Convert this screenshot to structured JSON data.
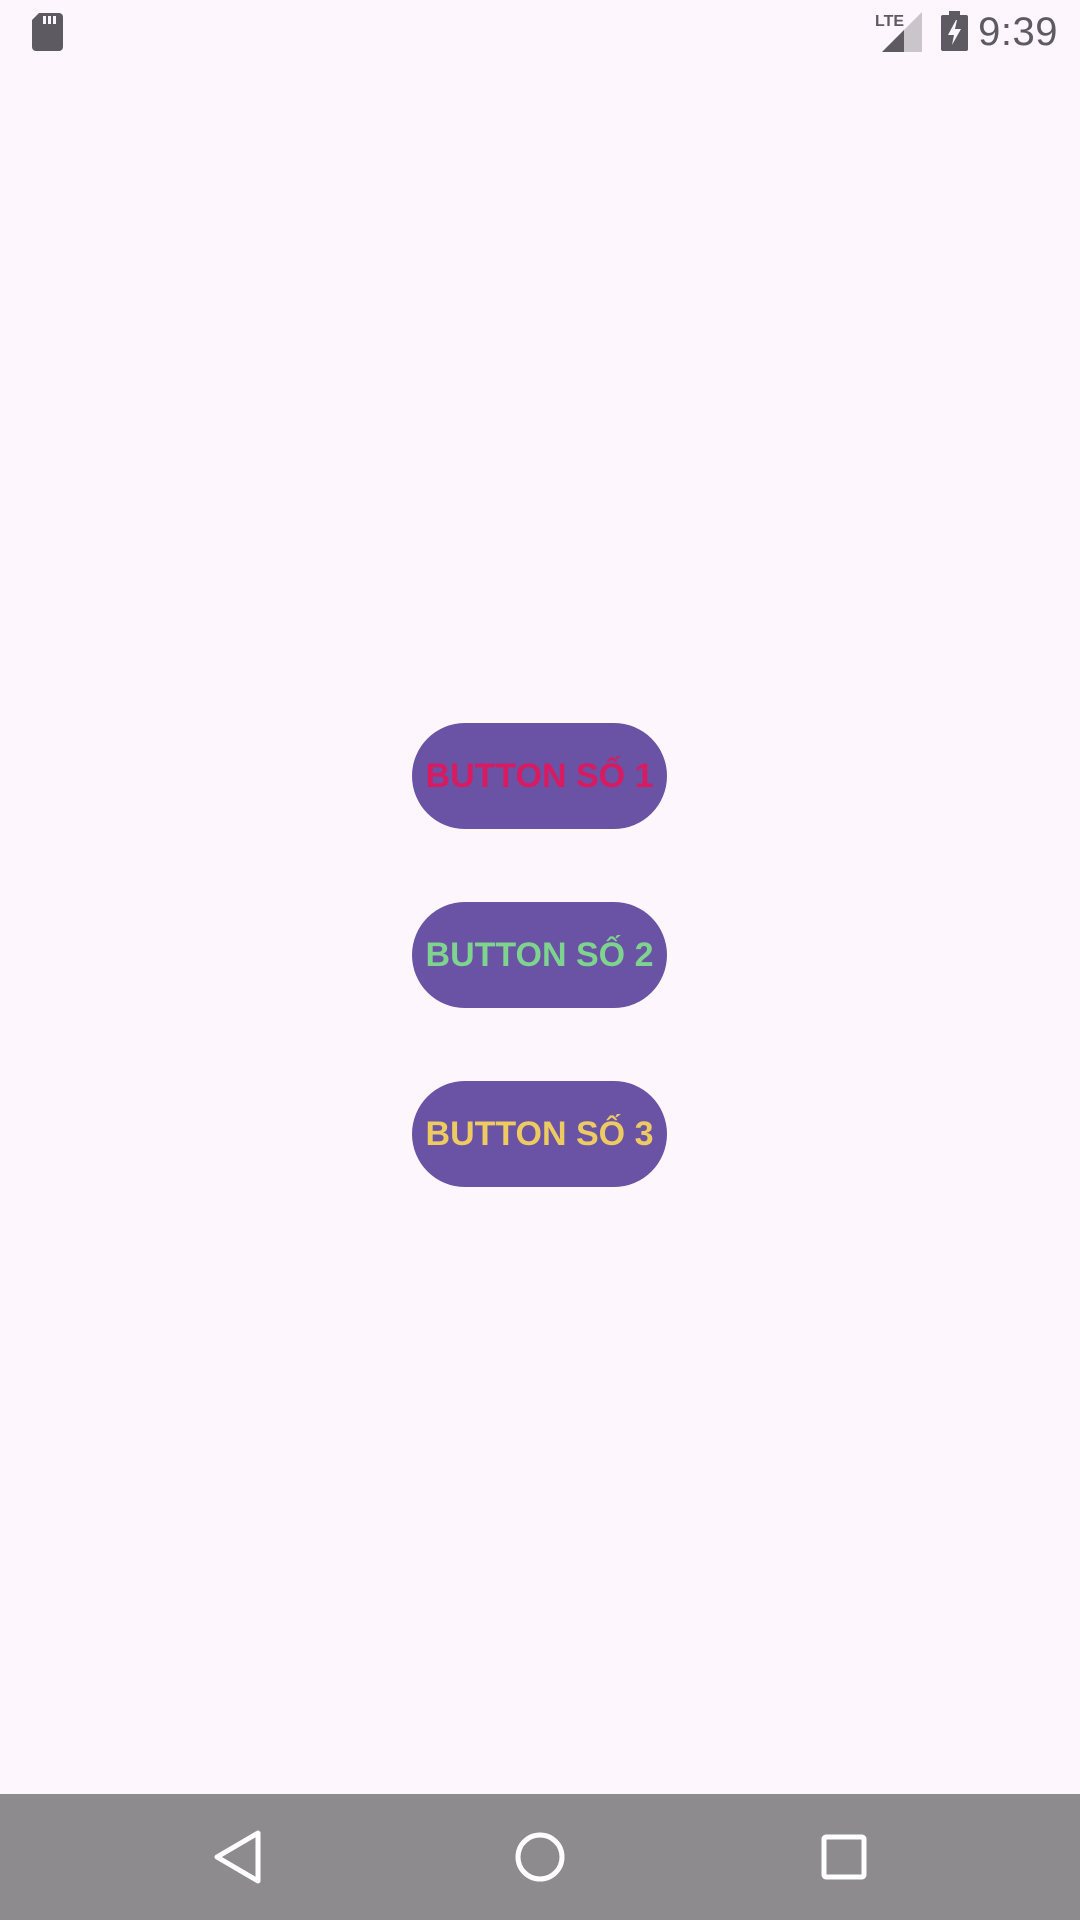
{
  "status_bar": {
    "time": "9:39",
    "network_label": "LTE",
    "icon_color": "#5E5A62",
    "icons": [
      "sd-card-icon",
      "lte-signal-icon",
      "battery-charging-icon"
    ]
  },
  "buttons": [
    {
      "label": "BUTTON SỐ 1",
      "text_color": "#D81B60",
      "bg_color": "#6A52A5"
    },
    {
      "label": "BUTTON SỐ 2",
      "text_color": "#7ED38E",
      "bg_color": "#6A52A5"
    },
    {
      "label": "BUTTON SỐ 3",
      "text_color": "#EDCB61",
      "bg_color": "#6A52A5"
    }
  ],
  "theme": {
    "background": "#FDF7FD",
    "nav_bar_bg": "#8E8B8F",
    "nav_icon_color": "#FFFFFF"
  },
  "nav_bar": {
    "icons": [
      "back-icon",
      "home-icon",
      "recents-icon"
    ]
  }
}
